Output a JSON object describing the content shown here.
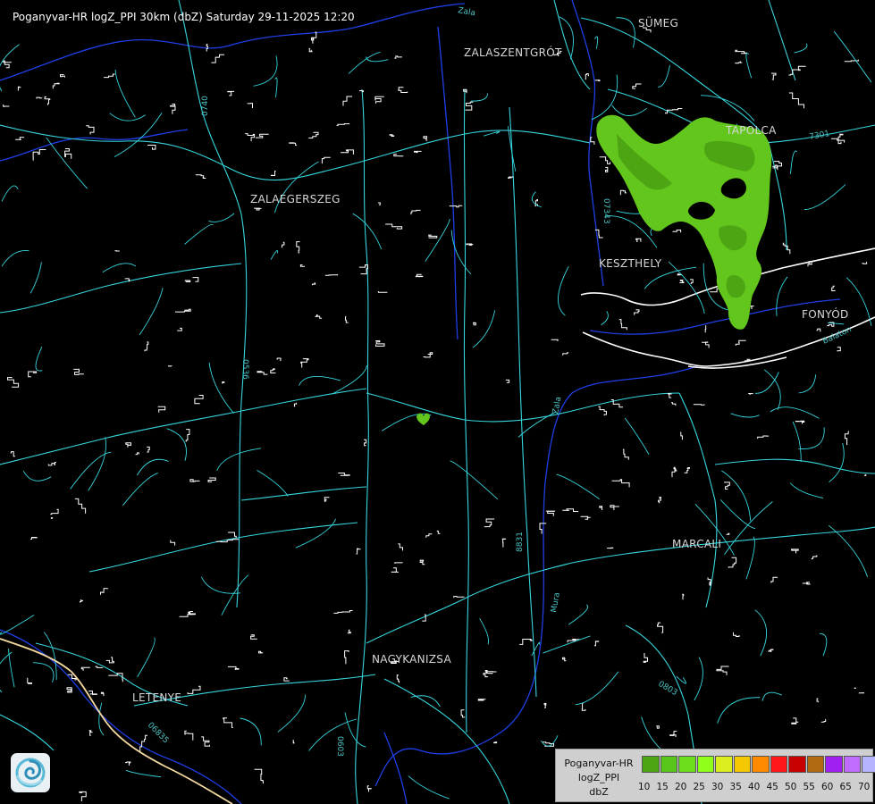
{
  "header": {
    "title": "Poganyvar-HR logZ_PPI 30km (dbZ) Saturday 29-11-2025 12:20"
  },
  "map": {
    "cities": [
      "SÜMEG",
      "ZALASZENTGRÓT",
      "TAPOLCA",
      "ZALAEGERSZEG",
      "KESZTHELY",
      "FONYÓD",
      "MARCALI",
      "NAGYKANIZSA",
      "LETENYE"
    ],
    "road_numbers": [
      "0740",
      "7301",
      "07343",
      "0536",
      "8831",
      "06835",
      "0803",
      "0603"
    ],
    "water_labels": [
      "Zala",
      "Balaton",
      "Zala",
      "Mura"
    ],
    "colors": {
      "background": "#000000",
      "roads": "#36d6de",
      "rivers": "#1f3fe6",
      "lake_shore": "#ffffff",
      "settlements": "#ffffff",
      "border": "#f4d9a0",
      "echo_light": "#63c61c",
      "echo_dark": "#4ea514"
    }
  },
  "legend": {
    "name_lines": [
      "Poganyvar-HR",
      "logZ_PPI",
      "dbZ"
    ],
    "ticks": [
      "10",
      "15",
      "20",
      "25",
      "30",
      "35",
      "40",
      "45",
      "50",
      "55",
      "60",
      "65",
      "70"
    ],
    "colors": [
      "#4ea514",
      "#58c51a",
      "#6dde1c",
      "#90ff1a",
      "#dcee1e",
      "#f4c800",
      "#ff8a00",
      "#ff1818",
      "#c80000",
      "#b06b10",
      "#a020f0",
      "#c06cff",
      "#b4b4ff"
    ]
  },
  "logo": {
    "icon": "radar-swirl-logo"
  }
}
